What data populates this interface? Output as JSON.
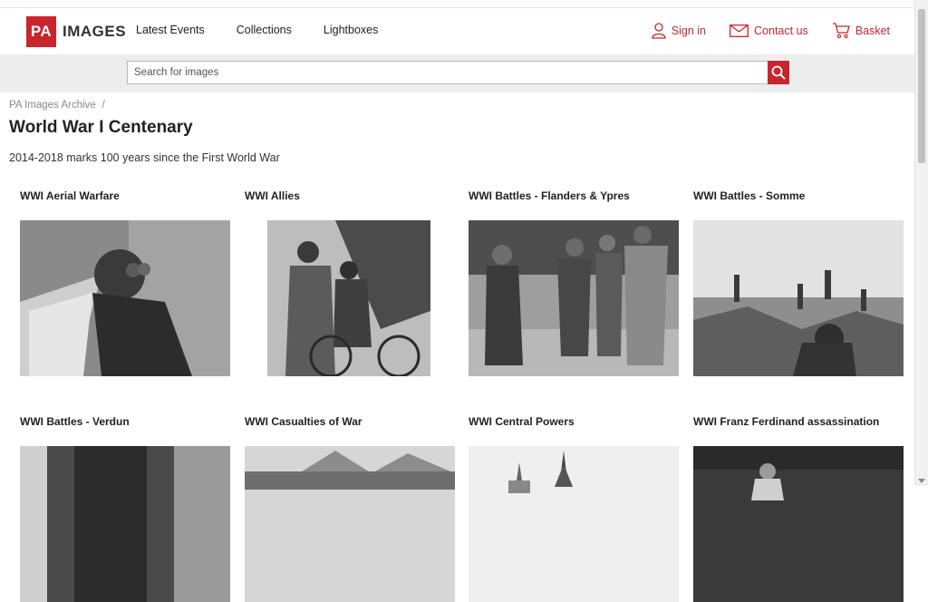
{
  "brand": {
    "mark": "PA",
    "name": "IMAGES"
  },
  "nav": [
    "Latest Events",
    "Collections",
    "Lightboxes"
  ],
  "header_links": [
    {
      "label": "Sign in",
      "icon": "user-icon"
    },
    {
      "label": "Contact us",
      "icon": "envelope-icon"
    },
    {
      "label": "Basket",
      "icon": "cart-icon"
    }
  ],
  "search": {
    "placeholder": "Search for images",
    "icon": "search-icon"
  },
  "breadcrumb": {
    "root": "PA Images Archive",
    "separator": "/"
  },
  "page": {
    "title": "World War I Centenary",
    "subtitle": "2014-2018 marks 100 years since the First World War"
  },
  "collections": [
    {
      "title": "WWI Aerial Warfare"
    },
    {
      "title": "WWI Allies"
    },
    {
      "title": "WWI Battles - Flanders & Ypres"
    },
    {
      "title": "WWI Battles - Somme"
    },
    {
      "title": "WWI Battles - Verdun"
    },
    {
      "title": "WWI Casualties of War"
    },
    {
      "title": "WWI Central Powers"
    },
    {
      "title": "WWI Franz Ferdinand assassination"
    }
  ],
  "colors": {
    "accent": "#c8252d",
    "search_band": "#ededed",
    "text": "#222222"
  }
}
